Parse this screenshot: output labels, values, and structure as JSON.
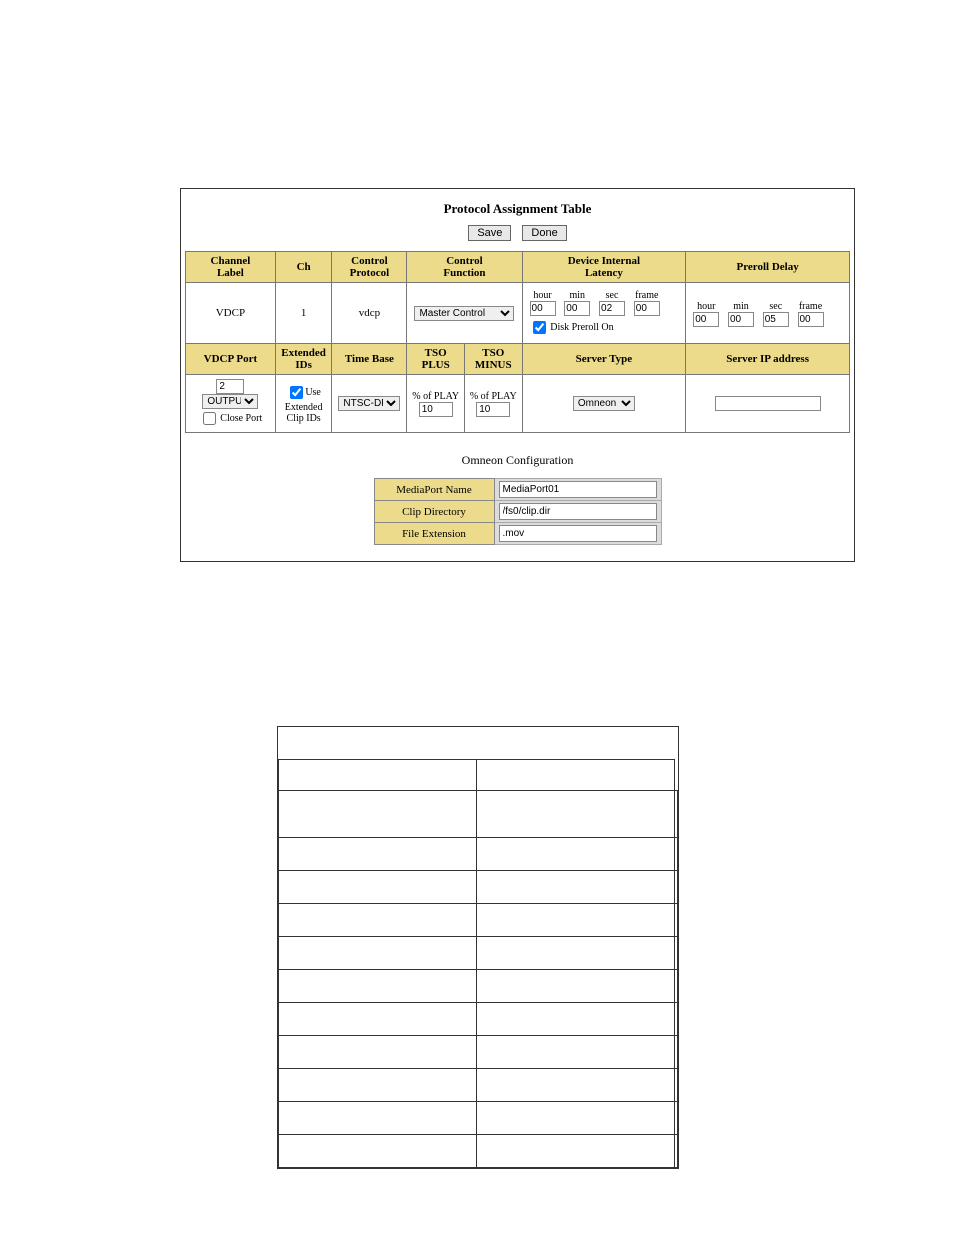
{
  "title": "Protocol Assignment Table",
  "buttons": {
    "save": "Save",
    "done": "Done"
  },
  "row1": {
    "h_channel_label": "Channel\nLabel",
    "h_ch": "Ch",
    "h_protocol": "Control\nProtocol",
    "h_function": "Control\nFunction",
    "h_latency": "Device Internal\nLatency",
    "h_preroll": "Preroll Delay",
    "channel_label": "VDCP",
    "ch": "1",
    "protocol": "vdcp",
    "function_selected": "Master Control",
    "timecode_labels": {
      "hour": "hour",
      "min": "min",
      "sec": "sec",
      "frame": "frame"
    },
    "latency": {
      "hour": "00",
      "min": "00",
      "sec": "02",
      "frame": "00"
    },
    "preroll": {
      "hour": "00",
      "min": "00",
      "sec": "05",
      "frame": "00"
    },
    "disk_preroll_label": "Disk Preroll On",
    "disk_preroll_checked": true
  },
  "row2": {
    "h_vdcp_port": "VDCP Port",
    "h_ext_ids": "Extended\nIDs",
    "h_timebase": "Time Base",
    "h_tso_plus": "TSO PLUS",
    "h_tso_minus": "TSO\nMINUS",
    "h_server_type": "Server Type",
    "h_server_ip": "Server IP address",
    "vdcp_port_value": "2",
    "vdcp_port_dir": "OUTPUT",
    "close_port_label": "Close Port",
    "close_port_checked": false,
    "use_ext_label": "Use\nExtended\nClip IDs",
    "use_ext_checked": true,
    "timebase_selected": "NTSC-DF",
    "tso_plus_label": "% of PLAY",
    "tso_plus_value": "10",
    "tso_minus_label": "% of PLAY",
    "tso_minus_value": "10",
    "server_type_selected": "Omneon",
    "server_ip_value": ""
  },
  "omneon": {
    "title": "Omneon Configuration",
    "mediaport_label": "MediaPort Name",
    "mediaport_value": "MediaPort01",
    "clipdir_label": "Clip Directory",
    "clipdir_value": "/fs0/clip.dir",
    "fileext_label": "File Extension",
    "fileext_value": ".mov"
  }
}
